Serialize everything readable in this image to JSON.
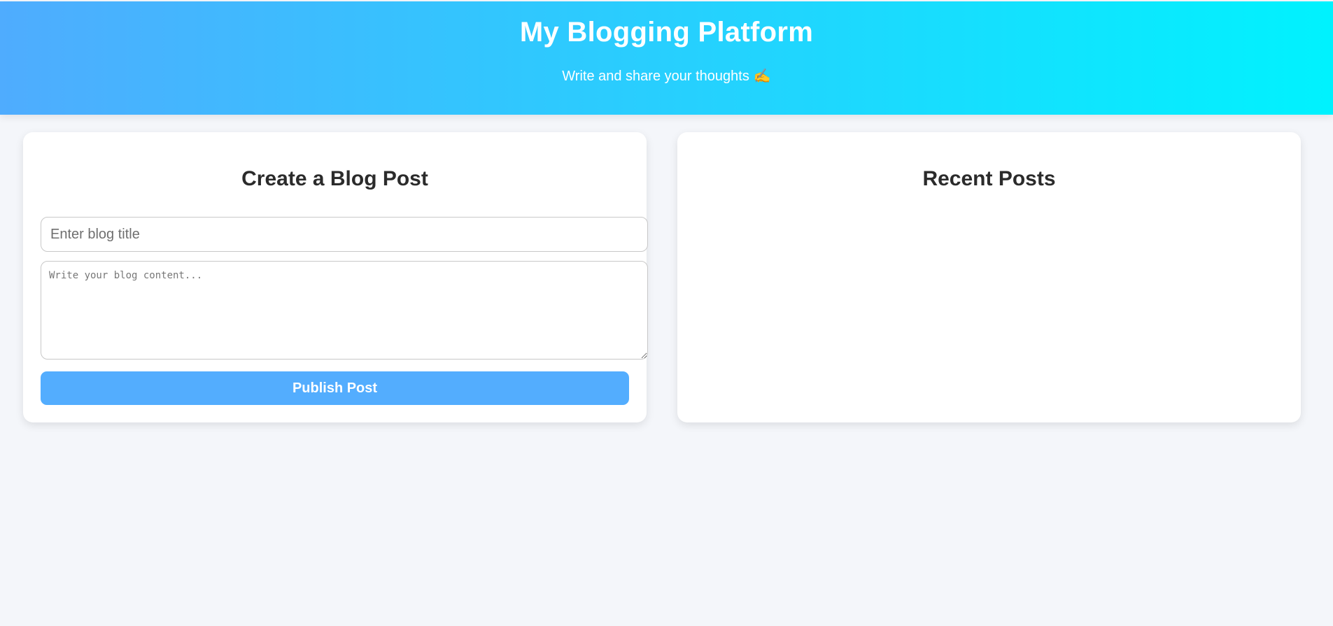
{
  "header": {
    "title": "My Blogging Platform",
    "subtitle": "Write and share your thoughts",
    "subtitle_emoji": "✍️",
    "gradient_start": "#4facfe",
    "gradient_end": "#00f2fe"
  },
  "create_post": {
    "heading": "Create a Blog Post",
    "title_value": "",
    "title_placeholder": "Enter blog title",
    "content_value": "",
    "content_placeholder": "Write your blog content...",
    "publish_label": "Publish Post",
    "button_color": "#53adfe"
  },
  "recent_posts": {
    "heading": "Recent Posts",
    "posts": []
  }
}
